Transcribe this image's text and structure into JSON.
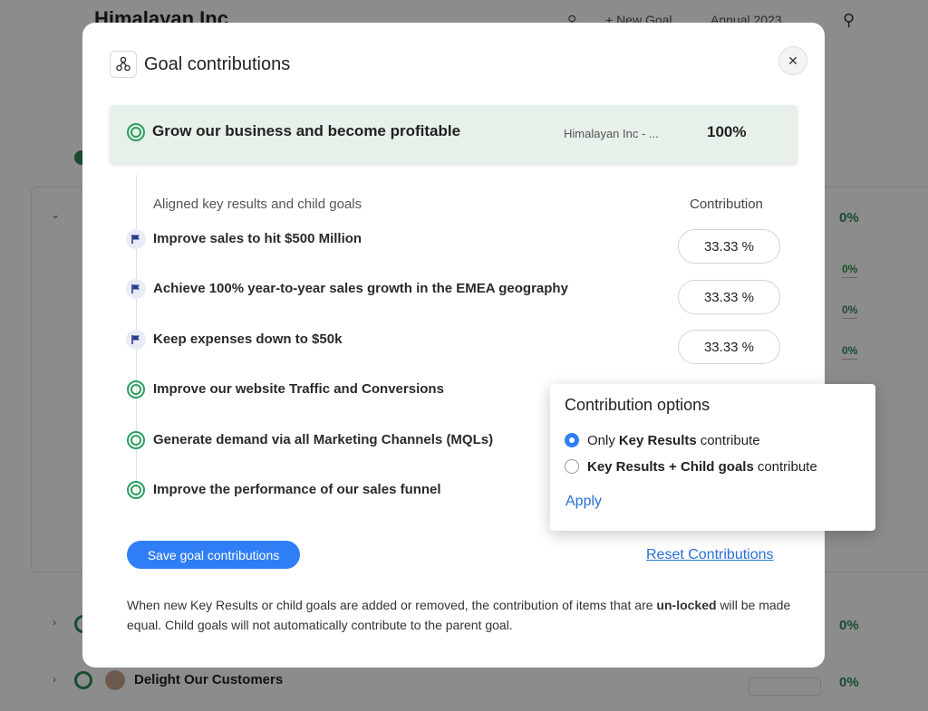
{
  "background": {
    "org_title": "Himalayan Inc",
    "new_goal": "+ New Goal",
    "period": "Annual 2023",
    "percentages": [
      "0%",
      "0%",
      "0%",
      "0%",
      "0%",
      "0%"
    ],
    "rows": [
      "Delight Our Customers"
    ]
  },
  "modal": {
    "title": "Goal contributions",
    "close_icon": "close-icon",
    "parent": {
      "name": "Grow our business and become profitable",
      "owner": "Himalayan Inc - ...",
      "percent": "100%"
    },
    "list_header": "Aligned key results and child goals",
    "contribution_header": "Contribution",
    "items": [
      {
        "label": "Improve sales to hit $500 Million",
        "icon": "flag-icon",
        "contribution": "33.33 %"
      },
      {
        "label": "Achieve 100% year-to-year sales growth in the EMEA geography",
        "icon": "flag-icon",
        "contribution": "33.33 %"
      },
      {
        "label": "Keep expenses down to $50k",
        "icon": "flag-icon",
        "contribution": "33.33 %"
      },
      {
        "label": "Improve our website Traffic and Conversions",
        "icon": "goal-icon"
      },
      {
        "label": "Generate demand via all Marketing Channels (MQLs)",
        "icon": "goal-icon"
      },
      {
        "label": "Improve the performance of our sales funnel",
        "icon": "goal-icon"
      }
    ],
    "save_label": "Save goal contributions",
    "reset_label": "Reset Contributions",
    "note": {
      "part1": "When new Key Results or child goals are added or removed, the contribution of items that are",
      "bold": "un-locked",
      "part2": "will be made equal. Child goals will not automatically contribute to the parent goal."
    }
  },
  "popover": {
    "title": "Contribution options",
    "option1": {
      "prefix": "Only",
      "bold": "Key Results",
      "suffix": "contribute",
      "selected": true
    },
    "option2": {
      "bold": "Key Results + Child goals",
      "suffix": "contribute",
      "selected": false
    },
    "apply_label": "Apply"
  },
  "colors": {
    "accent": "#2f7ef5",
    "goal_green": "#2e9e62",
    "link": "#2a6fd6",
    "parent_bg": "#e7f1ea"
  }
}
